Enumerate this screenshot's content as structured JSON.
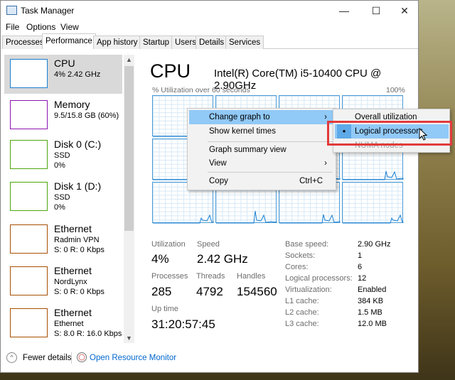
{
  "window": {
    "title": "Task Manager",
    "minimize": "—",
    "maximize": "☐",
    "close": "✕"
  },
  "menu": [
    "File",
    "Options",
    "View"
  ],
  "tabs": [
    "Processes",
    "Performance",
    "App history",
    "Startup",
    "Users",
    "Details",
    "Services"
  ],
  "active_tab": "Performance",
  "sidebar": [
    {
      "name": "CPU",
      "sub1": "4% 2.42 GHz",
      "color": "#1a7fd1",
      "selected": true
    },
    {
      "name": "Memory",
      "sub1": "9.5/15.8 GB (60%)",
      "color": "#8b12ae"
    },
    {
      "name": "Disk 0 (C:)",
      "sub1": "SSD",
      "sub2": "0%",
      "color": "#4da60c"
    },
    {
      "name": "Disk 1 (D:)",
      "sub1": "SSD",
      "sub2": "0%",
      "color": "#4da60c"
    },
    {
      "name": "Ethernet",
      "sub1": "Radmin VPN",
      "sub2": "S: 0 R: 0 Kbps",
      "color": "#a74f01"
    },
    {
      "name": "Ethernet",
      "sub1": "NordLynx",
      "sub2": "S: 0 R: 0 Kbps",
      "color": "#a74f01"
    },
    {
      "name": "Ethernet",
      "sub1": "Ethernet",
      "sub2": "S: 8.0 R: 16.0 Kbps",
      "color": "#a74f01"
    }
  ],
  "main": {
    "title": "CPU",
    "model": "Intel(R) Core(TM) i5-10400 CPU @ 2.90GHz",
    "graph_caption": "% Utilization over 60 seconds",
    "graph_max": "100%",
    "graph_mode": "Logical processors",
    "processor_count": 12,
    "stats": {
      "utilization_label": "Utilization",
      "utilization": "4%",
      "speed_label": "Speed",
      "speed": "2.42 GHz",
      "processes_label": "Processes",
      "processes": "285",
      "threads_label": "Threads",
      "threads": "4792",
      "handles_label": "Handles",
      "handles": "154560",
      "uptime_label": "Up time",
      "uptime": "31:20:57:45"
    },
    "specs": [
      [
        "Base speed:",
        "2.90 GHz"
      ],
      [
        "Sockets:",
        "1"
      ],
      [
        "Cores:",
        "6"
      ],
      [
        "Logical processors:",
        "12"
      ],
      [
        "Virtualization:",
        "Enabled"
      ],
      [
        "L1 cache:",
        "384 KB"
      ],
      [
        "L2 cache:",
        "1.5 MB"
      ],
      [
        "L3 cache:",
        "12.0 MB"
      ]
    ]
  },
  "context_menu": {
    "change_graph": "Change graph to",
    "kernel": "Show kernel times",
    "summary": "Graph summary view",
    "view": "View",
    "copy": "Copy",
    "copy_shortcut": "Ctrl+C",
    "arrow": "›"
  },
  "submenu": {
    "overall": "Overall utilization",
    "logical": "Logical processors",
    "numa": "NUMA nodes",
    "bullet": "●"
  },
  "footer": {
    "fewer": "Fewer details",
    "monitor": "Open Resource Monitor"
  },
  "colors": {
    "cpu": "#1a7fd1",
    "highlight": "#91c9f7",
    "annotation": "#e23b3b",
    "link": "#0066cc"
  }
}
